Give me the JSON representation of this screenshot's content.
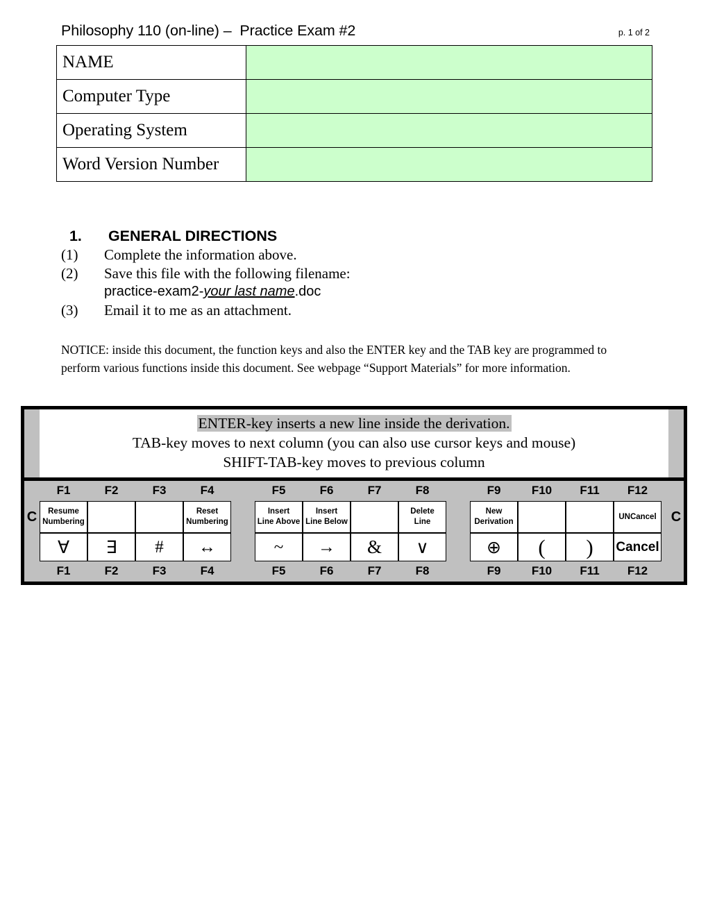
{
  "header": {
    "title": "Philosophy 110 (on-line) –  Practice Exam #2",
    "page_indicator": "p. 1 of 2"
  },
  "info_table": {
    "rows": [
      {
        "label": "NAME",
        "value": ""
      },
      {
        "label": "Computer Type",
        "value": ""
      },
      {
        "label": "Operating System",
        "value": ""
      },
      {
        "label": "Word Version Number",
        "value": ""
      }
    ],
    "value_fill_color": "#ccffcc"
  },
  "section": {
    "number": "1.",
    "heading": "GENERAL DIRECTIONS"
  },
  "directions": {
    "items": [
      {
        "num": "(1)",
        "text": "Complete the information above."
      },
      {
        "num": "(2)",
        "text": "Save this file with the following filename:"
      },
      {
        "num": "(3)",
        "text": "Email it to me as an attachment."
      }
    ],
    "filename": {
      "prefix": "practice-exam2-",
      "emphasis": "your last name",
      "suffix": ".doc"
    }
  },
  "notice": {
    "text": "NOTICE: inside this document, the function keys and also the ENTER key and the TAB key are programmed to perform various functions inside this document.  See webpage “Support Materials” for more information."
  },
  "fkey_panel": {
    "banner": {
      "line1": "ENTER-key inserts a new line inside the derivation.",
      "line2": "TAB-key moves to next column (you can also use cursor keys and mouse)",
      "line3": "SHIFT-TAB-key moves to previous column"
    },
    "corner_label": "C",
    "groups": [
      {
        "keys": [
          {
            "fkey": "F1",
            "function": "Resume Numbering",
            "symbol": "∀"
          },
          {
            "fkey": "F2",
            "function": "",
            "symbol": "∃"
          },
          {
            "fkey": "F3",
            "function": "",
            "symbol": "#"
          },
          {
            "fkey": "F4",
            "function": "Reset Numbering",
            "symbol": "↔"
          }
        ]
      },
      {
        "keys": [
          {
            "fkey": "F5",
            "function": "Insert Line Above",
            "symbol": "~"
          },
          {
            "fkey": "F6",
            "function": "Insert Line Below",
            "symbol": "→"
          },
          {
            "fkey": "F7",
            "function": "",
            "symbol": "&"
          },
          {
            "fkey": "F8",
            "function": "Delete Line",
            "symbol": "∨"
          }
        ]
      },
      {
        "keys": [
          {
            "fkey": "F9",
            "function": "New Derivation",
            "symbol": "⊕"
          },
          {
            "fkey": "F10",
            "function": "",
            "symbol": "("
          },
          {
            "fkey": "F11",
            "function": "",
            "symbol": ")"
          },
          {
            "fkey": "F12",
            "function": "UNCancel",
            "symbol": "Cancel"
          }
        ]
      }
    ]
  },
  "colors": {
    "panel_gray": "#c0c0c0",
    "green_fill": "#ccffcc",
    "border_black": "#000000"
  }
}
